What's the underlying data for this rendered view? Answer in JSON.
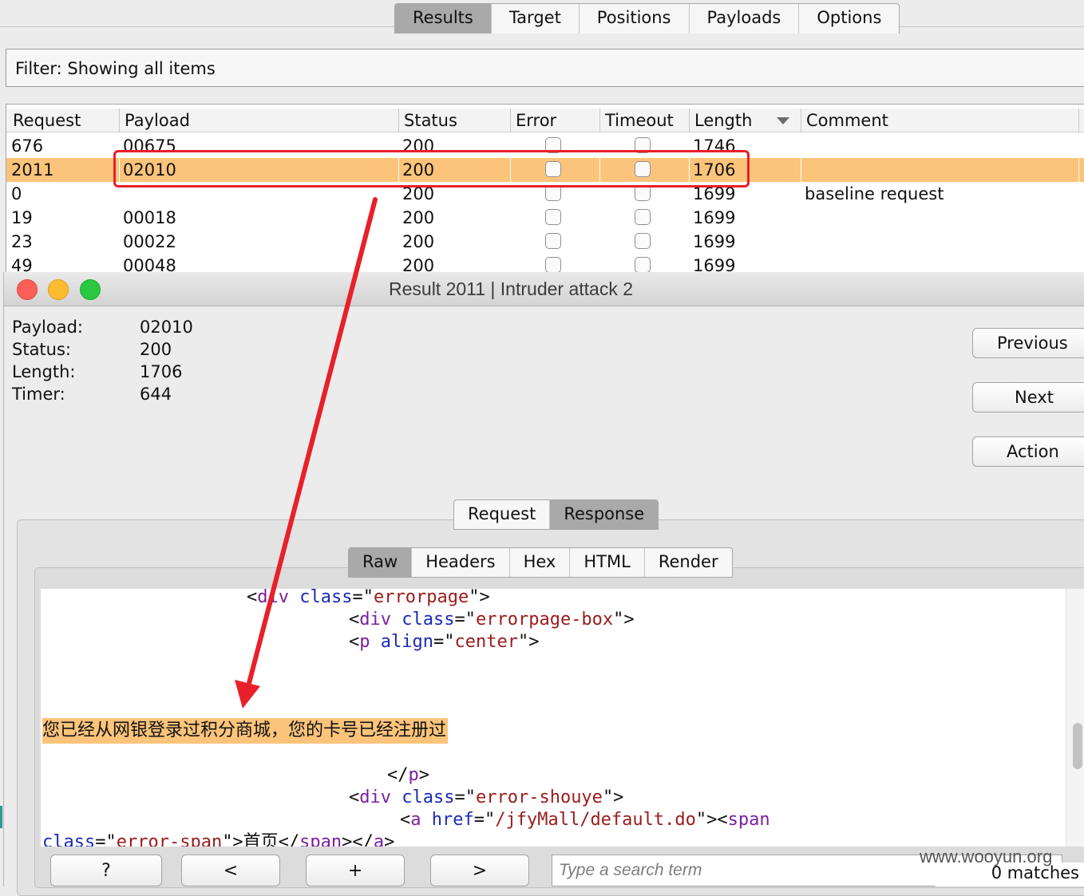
{
  "top_tabs": [
    "Results",
    "Target",
    "Positions",
    "Payloads",
    "Options"
  ],
  "top_active": "Results",
  "filter": {
    "text": "Filter:  Showing all items"
  },
  "table": {
    "columns": [
      "Request",
      "Payload",
      "Status",
      "Error",
      "Timeout",
      "Length",
      "Comment"
    ],
    "sort_column": "Length",
    "rows": [
      {
        "request": "676",
        "payload": "00675",
        "status": "200",
        "length": "1746",
        "comment": ""
      },
      {
        "request": "2011",
        "payload": "02010",
        "status": "200",
        "length": "1706",
        "comment": "",
        "selected": true
      },
      {
        "request": "0",
        "payload": "",
        "status": "200",
        "length": "1699",
        "comment": "baseline request"
      },
      {
        "request": "19",
        "payload": "00018",
        "status": "200",
        "length": "1699",
        "comment": ""
      },
      {
        "request": "23",
        "payload": "00022",
        "status": "200",
        "length": "1699",
        "comment": ""
      },
      {
        "request": "49",
        "payload": "00048",
        "status": "200",
        "length": "1699",
        "comment": ""
      }
    ]
  },
  "dialog": {
    "title": "Result 2011 | Intruder attack 2",
    "info": [
      {
        "label": "Payload:",
        "value": "02010"
      },
      {
        "label": "Status:",
        "value": "200"
      },
      {
        "label": "Length:",
        "value": "1706"
      },
      {
        "label": "Timer:",
        "value": "644"
      }
    ],
    "buttons": {
      "previous": "Previous",
      "next": "Next",
      "action": "Action"
    },
    "rr_tabs": [
      "Request",
      "Response"
    ],
    "rr_active": "Response",
    "view_tabs": [
      "Raw",
      "Headers",
      "Hex",
      "HTML",
      "Render"
    ],
    "view_active": "Raw",
    "highlighted_text": "您已经从网银登录过积分商城，您的卡号已经注册过",
    "bottom": {
      "help": "?",
      "prev": "<",
      "add": "+",
      "next": ">",
      "search_placeholder": "Type a search term",
      "matches": "0 matches"
    }
  },
  "watermark": "www.wooyun.org",
  "colors": {
    "selected_row": "#fcc47a",
    "annotation": "#e8202a",
    "active_tab": "#a9a9a9"
  }
}
